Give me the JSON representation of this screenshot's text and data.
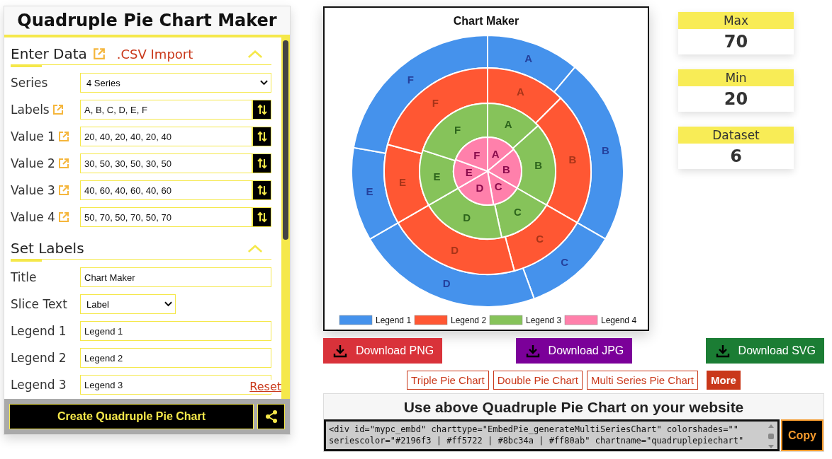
{
  "panel": {
    "title": "Quadruple Pie Chart Maker",
    "sections": [
      {
        "heading": "Enter Data",
        "link": ".CSV Import",
        "expanded": true,
        "rows": [
          {
            "kind": "select",
            "label": "Series",
            "value": "4 Series",
            "info": false
          },
          {
            "kind": "swap",
            "label": "Labels",
            "value": "A, B, C, D, E, F",
            "info": true
          },
          {
            "kind": "swap",
            "label": "Value 1",
            "value": "20, 40, 20, 40, 20, 40",
            "info": true
          },
          {
            "kind": "swap",
            "label": "Value 2",
            "value": "30, 50, 30, 50, 30, 50",
            "info": true
          },
          {
            "kind": "swap",
            "label": "Value 3",
            "value": "40, 60, 40, 60, 40, 60",
            "info": true
          },
          {
            "kind": "swap",
            "label": "Value 4",
            "value": "50, 70, 50, 70, 50, 70",
            "info": true
          }
        ]
      },
      {
        "heading": "Set Labels",
        "expanded": true,
        "rows": [
          {
            "kind": "text",
            "label": "Title",
            "value": "Chart Maker",
            "info": false
          },
          {
            "kind": "select-small",
            "label": "Slice Text",
            "value": "Label",
            "info": false
          },
          {
            "kind": "text",
            "label": "Legend 1",
            "value": "Legend 1",
            "info": false
          },
          {
            "kind": "text",
            "label": "Legend 2",
            "value": "Legend 2",
            "info": false
          },
          {
            "kind": "text",
            "label": "Legend 3",
            "value": "Legend 3",
            "info": false
          }
        ]
      }
    ],
    "reset": "Reset",
    "create_button": "Create Quadruple Pie Chart"
  },
  "chart": {
    "chart_data": {
      "type": "donut",
      "title": "Chart Maker",
      "categories": [
        "A",
        "B",
        "C",
        "D",
        "E",
        "F"
      ],
      "data_labels": "label",
      "legend": "bottom",
      "series": [
        {
          "name": "Legend 1",
          "color": "#4592ec",
          "values": [
            11.11,
            22.22,
            11.11,
            22.22,
            11.11,
            22.23
          ]
        },
        {
          "name": "Legend 2",
          "color": "#ff5733",
          "values": [
            12.5,
            20.83,
            12.5,
            20.83,
            12.5,
            20.84
          ]
        },
        {
          "name": "Legend 3",
          "color": "#86c35a",
          "values": [
            13.33,
            20,
            13.33,
            20,
            13.34,
            20
          ]
        },
        {
          "name": "Legend 4",
          "color": "#ff80ab",
          "values": [
            13.89,
            19.44,
            13.89,
            19.44,
            13.89,
            19.45
          ]
        }
      ]
    }
  },
  "stats": [
    {
      "label": "Max",
      "value": "70"
    },
    {
      "label": "Min",
      "value": "20"
    },
    {
      "label": "Dataset",
      "value": "6"
    }
  ],
  "downloads": [
    {
      "label": "Download PNG",
      "color": "#d9323a"
    },
    {
      "label": "Download JPG",
      "color": "#7b0099"
    },
    {
      "label": "Download SVG",
      "color": "#1b7d34"
    }
  ],
  "links": [
    "Triple Pie Chart",
    "Double Pie Chart",
    "Multi Series Pie Chart"
  ],
  "more": "More",
  "embed": {
    "title": "Use above Quadruple Pie Chart on your website",
    "code": "<div id=\"mypc_embd\" charttype=\"EmbedPie_generateMultiSeriesChart\" colorshades=\"\"\nseriescolor=\"#2196f3 | #ff5722 | #8bc34a | #ff80ab\" chartname=\"quadruplepiechart\"",
    "copy": "Copy"
  }
}
